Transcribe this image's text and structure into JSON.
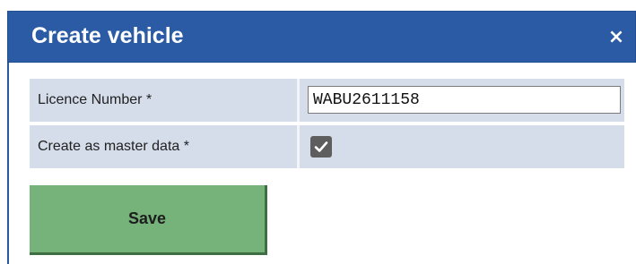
{
  "dialog": {
    "title": "Create vehicle",
    "close_glyph": "×",
    "close_icon": "close-icon"
  },
  "form": {
    "rows": [
      {
        "label": "Licence Number *",
        "input_value": "WABU2611158"
      },
      {
        "label": "Create as master data *",
        "checked": true,
        "checkbox_icon": "checkmark-icon"
      }
    ]
  },
  "actions": {
    "save_label": "Save"
  },
  "colors": {
    "titlebar": "#2a5ba4",
    "row_background": "#d5dcea",
    "save_button": "#76b37b",
    "checkbox": "#5e5e5e"
  }
}
